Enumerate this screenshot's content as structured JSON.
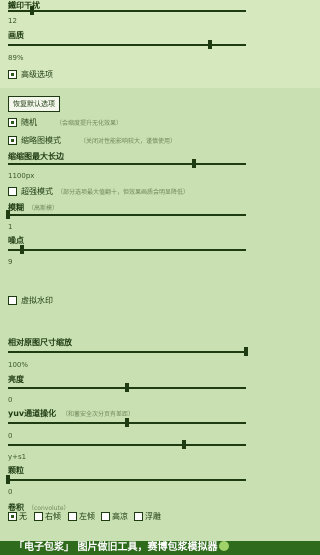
{
  "block_size": {
    "label": "鐵印干扰",
    "value": "12",
    "level": 0.1
  },
  "quality": {
    "label": "画质",
    "value": "89%",
    "level": 0.85
  },
  "advanced": {
    "label": "高级选项",
    "checked": true
  },
  "restore_button": "恢复默认选项",
  "random": {
    "label": "随机",
    "hint": "（会缩度提升无化效果）",
    "checked": true
  },
  "thumbnail_mode": {
    "label": "缩略图模式",
    "hint": "（关闭对性能影响较大，谨慎使用）",
    "checked": true
  },
  "thumb_max_side": {
    "label": "缩缩图最大长边",
    "value": "1100px",
    "level": 0.78
  },
  "super_mode": {
    "label": "超强模式",
    "hint": "（部分选项最大值翻十，但效果画质会明显降低）",
    "checked": false
  },
  "blur": {
    "label": "模糊",
    "hint": "（高斯模）",
    "value": "1",
    "level": 0.0
  },
  "noise": {
    "label": "噪点",
    "value": "9",
    "level": 0.06
  },
  "watermark": {
    "label": "虚拟水印",
    "checked": false
  },
  "relative_scale": {
    "label": "相对原图尺寸缩放",
    "value": "100%",
    "level": 1.0
  },
  "brightness": {
    "label": "亮度",
    "value": "0",
    "level": 0.5
  },
  "yuv": {
    "label": "yuv通道操化",
    "hint": "（和蓄安全次分页有差距）",
    "value": "0",
    "level": 0.5
  },
  "yuv_extra": {
    "value": "y+s1",
    "level": 0.74
  },
  "grain": {
    "label": "颗粒",
    "value": "0",
    "level": 0.0
  },
  "convolve": {
    "label": "卷积",
    "hint": "（convolute）",
    "options": [
      "无",
      "右倾",
      "左倾",
      "高凉",
      "浮雕"
    ],
    "selected": 0
  },
  "footer": {
    "title": "「电子包浆」 图片做旧工具，赛博包浆模拟器",
    "icon": "smile-emoji-icon"
  }
}
